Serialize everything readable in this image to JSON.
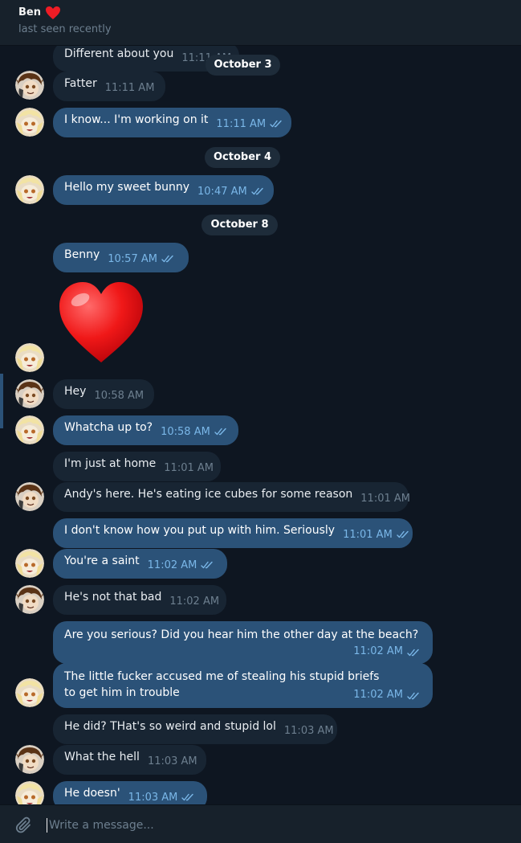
{
  "header": {
    "name": "Ben",
    "status": "last seen recently"
  },
  "compose": {
    "placeholder": "Write a message..."
  },
  "messages": [
    {
      "text": "Different about you",
      "time": "11:11 AM"
    },
    {
      "text": "Fatter",
      "time": "11:11 AM"
    },
    {
      "text": "I know... I'm working on it",
      "time": "11:11 AM"
    },
    {
      "text": "Hello my sweet bunny",
      "time": "10:47 AM"
    },
    {
      "text": "Benny",
      "time": "10:57 AM"
    },
    {
      "text": "Hey",
      "time": "10:58 AM"
    },
    {
      "text": "Whatcha up to?",
      "time": "10:58 AM"
    },
    {
      "text": "I'm just at home",
      "time": "11:01 AM"
    },
    {
      "text": "Andy's here. He's eating ice cubes for some reason",
      "time": "11:01 AM"
    },
    {
      "text": "I don't know how you put up with him. Seriously",
      "time": "11:01 AM"
    },
    {
      "text": "You're a saint",
      "time": "11:02 AM"
    },
    {
      "text": "He's not that bad",
      "time": "11:02 AM"
    },
    {
      "text": "Are you serious? Did you hear him the other day at the beach?",
      "time": "11:02 AM"
    },
    {
      "text": "The little fucker accused me of stealing his stupid briefs to get him in trouble",
      "time": "11:02 AM"
    },
    {
      "text": "He did? THat's so weird and stupid lol",
      "time": "11:03 AM"
    },
    {
      "text": "What the hell",
      "time": "11:03 AM"
    },
    {
      "text": "He doesn'",
      "time": "11:03 AM"
    }
  ],
  "dates": [
    "October 3",
    "October 4",
    "October 8"
  ],
  "colors": {
    "background": "#0e1621",
    "header": "#17212b",
    "incoming_bubble": "#182533",
    "outgoing_bubble": "#2b5278",
    "read_check": "#7ab7e8"
  }
}
